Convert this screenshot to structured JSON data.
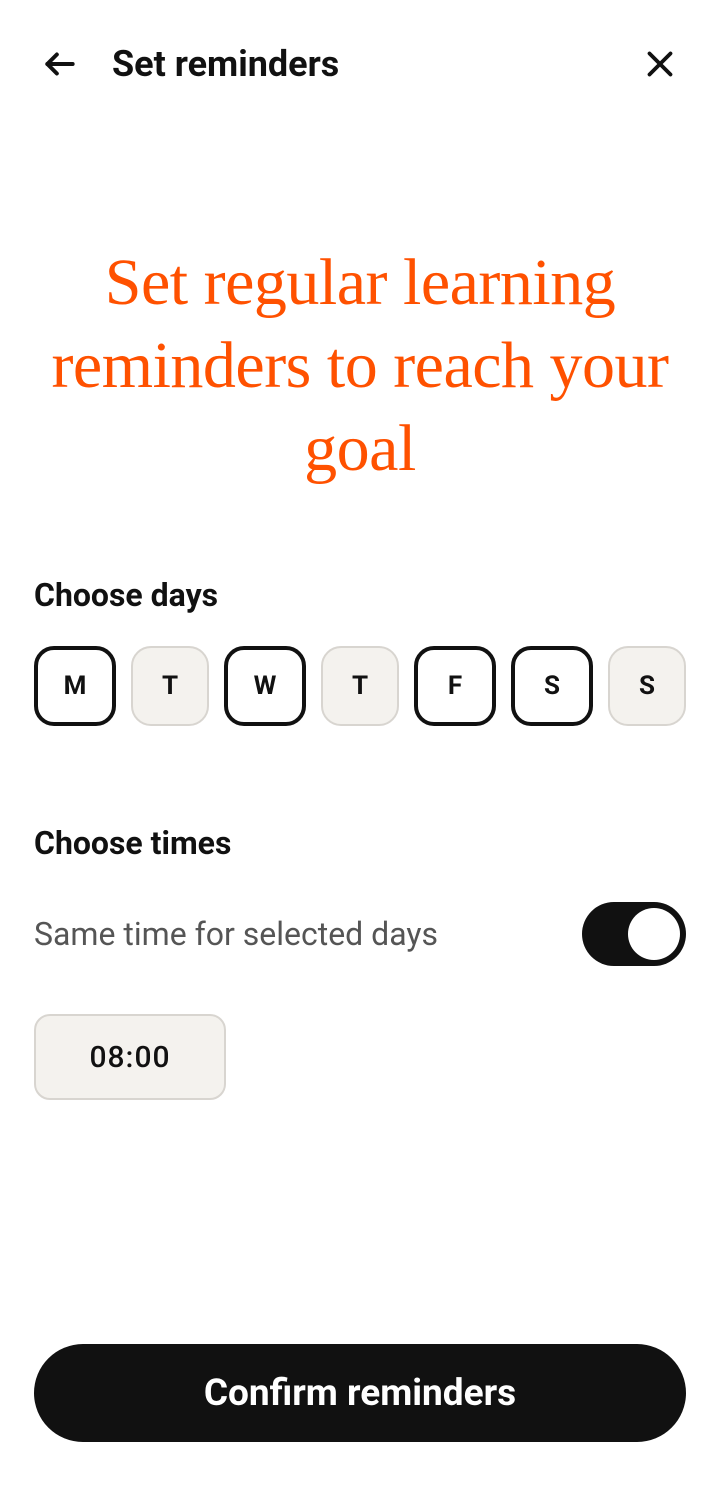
{
  "header": {
    "title": "Set reminders"
  },
  "hero": "Set regular learning reminders to reach your goal",
  "choose_days": {
    "title": "Choose days",
    "days": [
      {
        "label": "M",
        "selected": true
      },
      {
        "label": "T",
        "selected": false
      },
      {
        "label": "W",
        "selected": true
      },
      {
        "label": "T",
        "selected": false
      },
      {
        "label": "F",
        "selected": true
      },
      {
        "label": "S",
        "selected": true
      },
      {
        "label": "S",
        "selected": false
      }
    ]
  },
  "choose_times": {
    "title": "Choose times",
    "same_time_label": "Same time for selected days",
    "same_time_enabled": true,
    "time": "08:00"
  },
  "confirm_label": "Confirm reminders"
}
